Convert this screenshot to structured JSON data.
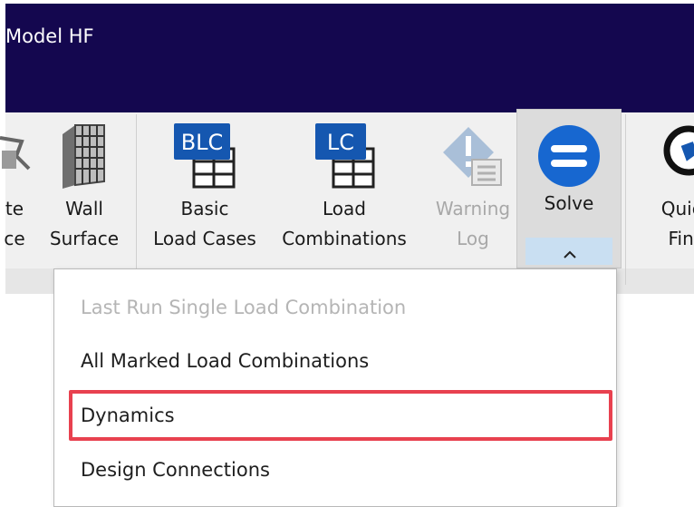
{
  "window": {
    "title": "Model HF",
    "colors": {
      "titlebar": "#14074f",
      "highlight": "#e8414f"
    }
  },
  "ribbon": {
    "partial_left": {
      "line1": "te",
      "line2": "ce",
      "icon": "partial-tool-icon"
    },
    "wall_surface": {
      "line1": "Wall",
      "line2": "Surface",
      "icon": "wall-surface-icon"
    },
    "basic_load_cases": {
      "badge": "BLC",
      "line1": "Basic",
      "line2": "Load Cases",
      "icon": "blc-table-icon"
    },
    "load_combinations": {
      "badge": "LC",
      "line1": "Load",
      "line2": "Combinations",
      "icon": "lc-table-icon"
    },
    "warning_log": {
      "line1": "Warning",
      "line2": "Log",
      "enabled": false,
      "icon": "warning-log-icon"
    },
    "solve": {
      "label": "Solve",
      "icon": "equals-circle-icon",
      "dropdown_icon": "chevron-up-icon"
    },
    "quick_find": {
      "line1": "Quick",
      "line2": "Find",
      "icon": "magnifier-tag-icon"
    }
  },
  "solve_menu": {
    "items": [
      {
        "label": "Last Run Single Load Combination",
        "enabled": false
      },
      {
        "label": "All Marked Load Combinations",
        "enabled": true
      },
      {
        "label": "Dynamics",
        "enabled": true,
        "highlighted": true
      },
      {
        "label": "Design Connections",
        "enabled": true
      }
    ]
  }
}
